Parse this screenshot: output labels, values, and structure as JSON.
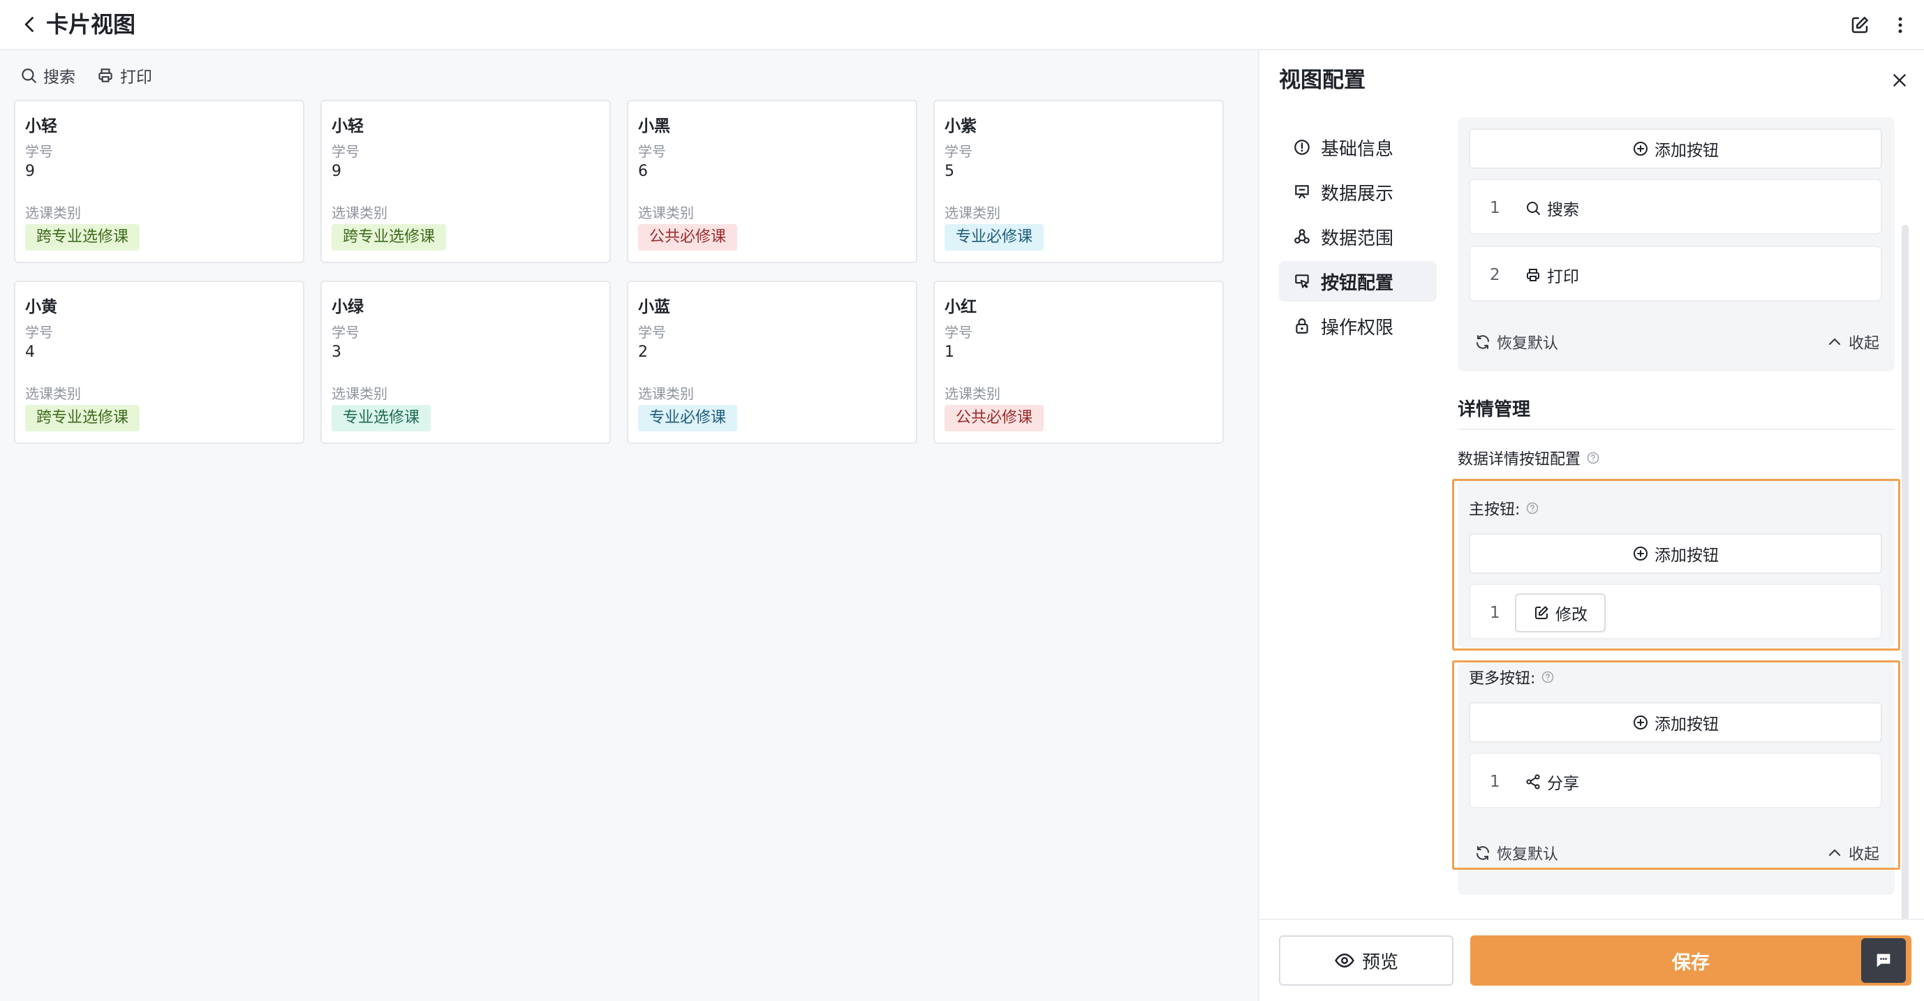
{
  "header": {
    "title": "卡片视图"
  },
  "toolbar": {
    "search_label": "搜索",
    "print_label": "打印"
  },
  "cards": [
    {
      "name": "小轻",
      "id_label": "学号",
      "id": "9",
      "type_label": "选课类别",
      "tag": "跨专业选修课"
    },
    {
      "name": "小轻",
      "id_label": "学号",
      "id": "9",
      "type_label": "选课类别",
      "tag": "跨专业选修课"
    },
    {
      "name": "小黑",
      "id_label": "学号",
      "id": "6",
      "type_label": "选课类别",
      "tag": "公共必修课"
    },
    {
      "name": "小紫",
      "id_label": "学号",
      "id": "5",
      "type_label": "选课类别",
      "tag": "专业必修课"
    },
    {
      "name": "小黄",
      "id_label": "学号",
      "id": "4",
      "type_label": "选课类别",
      "tag": "跨专业选修课"
    },
    {
      "name": "小绿",
      "id_label": "学号",
      "id": "3",
      "type_label": "选课类别",
      "tag": "专业选修课"
    },
    {
      "name": "小蓝",
      "id_label": "学号",
      "id": "2",
      "type_label": "选课类别",
      "tag": "专业必修课"
    },
    {
      "name": "小红",
      "id_label": "学号",
      "id": "1",
      "type_label": "选课类别",
      "tag": "公共必修课"
    }
  ],
  "tag_colors": {
    "跨专业选修课": {
      "bg": "#e8f6d8",
      "fg": "#3e6b1c"
    },
    "公共必修课": {
      "bg": "#fbe3e3",
      "fg": "#9b2c2c"
    },
    "专业必修课": {
      "bg": "#dff3fb",
      "fg": "#1d5d7a"
    },
    "专业选修课": {
      "bg": "#dcf6ee",
      "fg": "#1e6b52"
    }
  },
  "panel": {
    "title": "视图配置",
    "nav": [
      "基础信息",
      "数据展示",
      "数据范围",
      "按钮配置",
      "操作权限"
    ],
    "active_nav": "按钮配置",
    "add_button_label": "添加按钮",
    "top_buttons": [
      {
        "index": "1",
        "label": "搜索",
        "icon": "search-icon"
      },
      {
        "index": "2",
        "label": "打印",
        "icon": "printer-icon"
      }
    ],
    "restore_label": "恢复默认",
    "collapse_label": "收起",
    "detail_section_title": "详情管理",
    "detail_config_label": "数据详情按钮配置",
    "main_buttons_label": "主按钮:",
    "main_buttons": [
      {
        "index": "1",
        "label": "修改",
        "icon": "edit-icon"
      }
    ],
    "more_buttons_label": "更多按钮:",
    "more_buttons": [
      {
        "index": "1",
        "label": "分享",
        "icon": "share-icon"
      }
    ],
    "preview_label": "预览",
    "save_label": "保存"
  },
  "colors": {
    "accent": "#ee9a4a",
    "highlight_border": "#f0a050"
  }
}
